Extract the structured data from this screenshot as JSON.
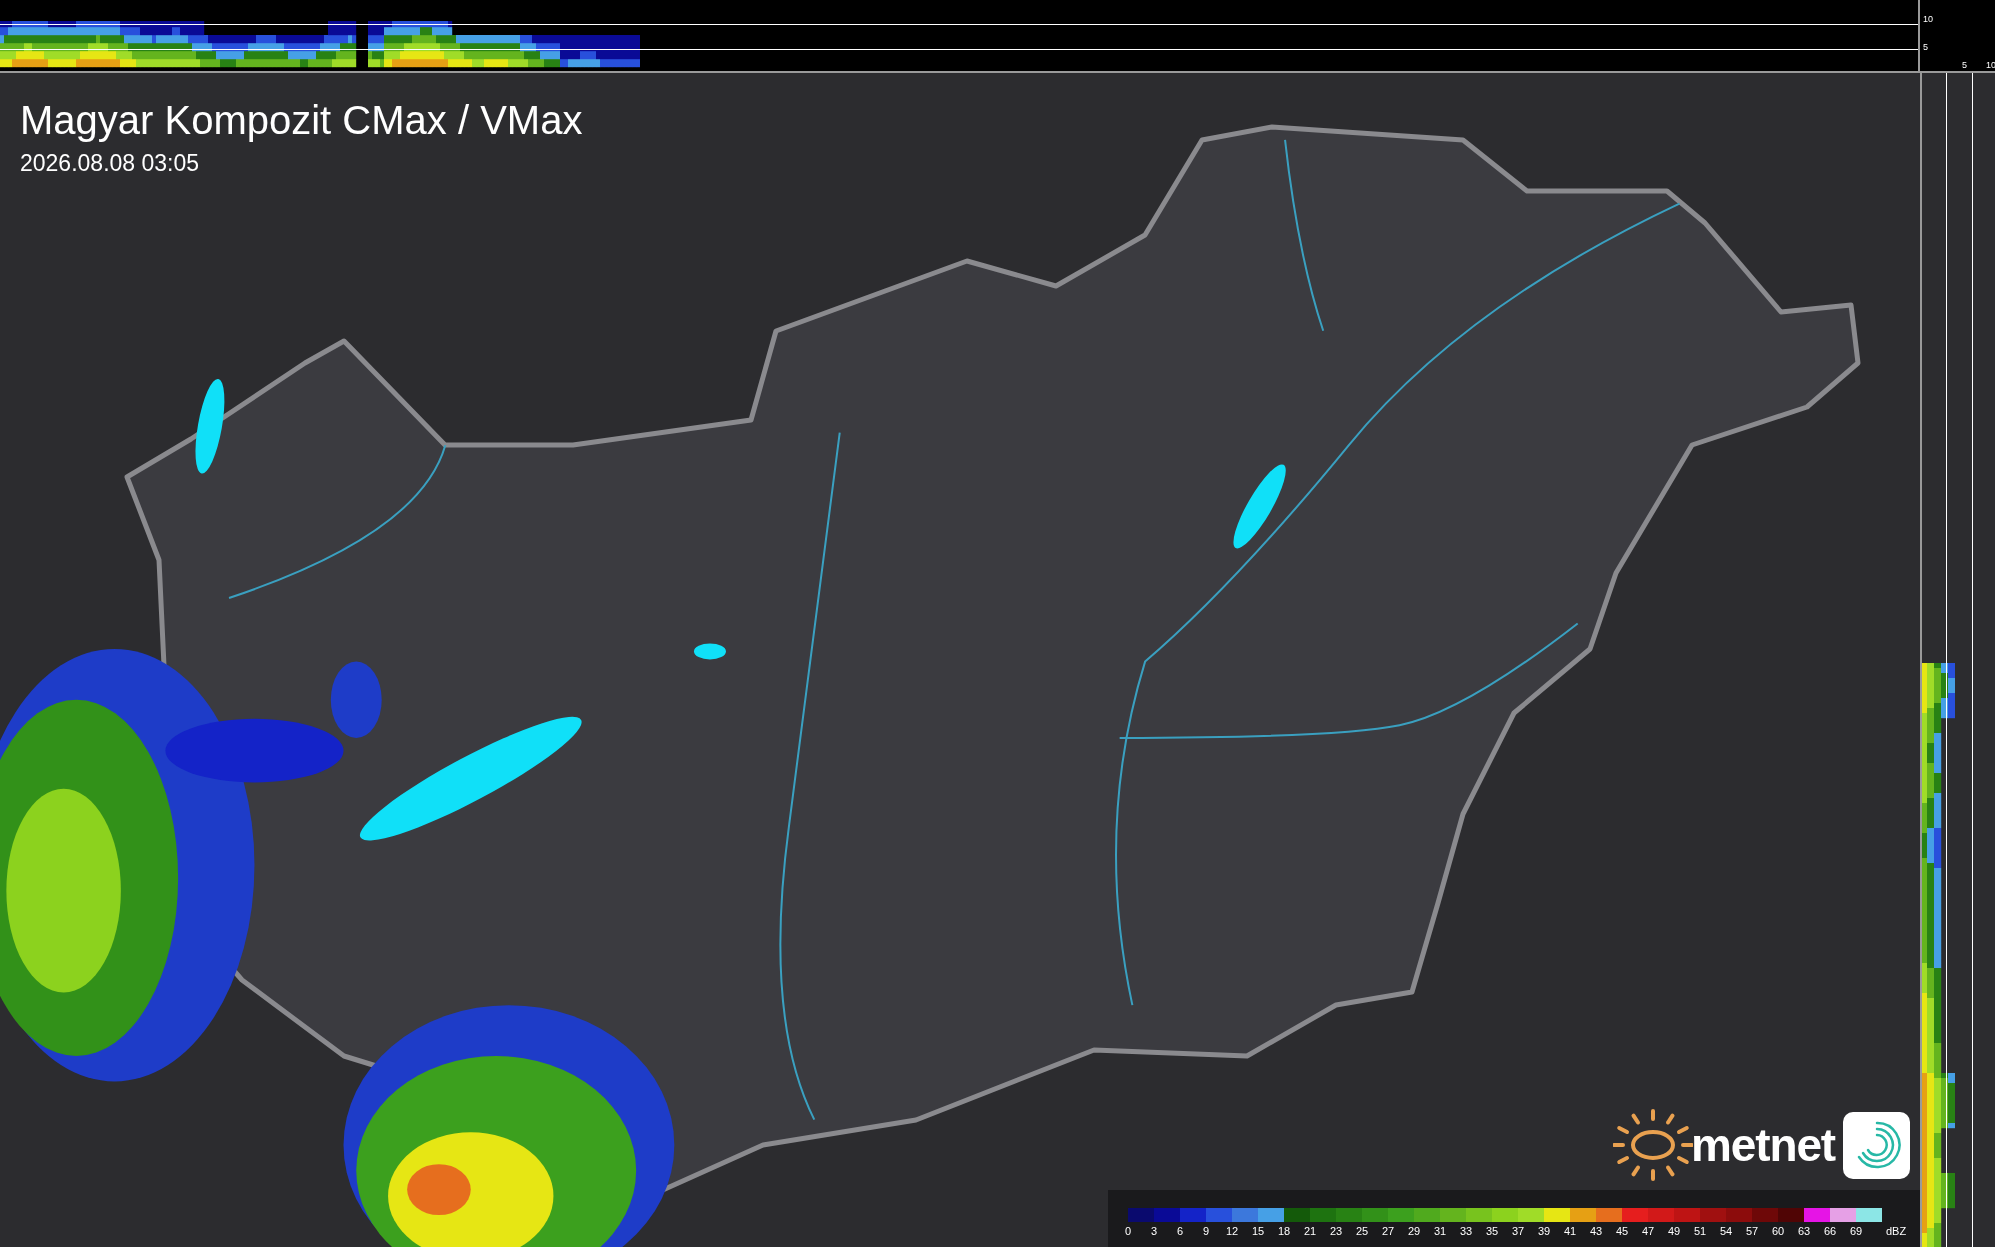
{
  "title": "Magyar Kompozit CMax / VMax",
  "timestamp": "2026.08.08 03:05",
  "top_profile": {
    "scale_labels": [
      "10",
      "5"
    ]
  },
  "side_profile": {
    "scale_labels": [
      "5",
      "10"
    ]
  },
  "logo": {
    "text": "metnet"
  },
  "legend": {
    "unit": "dBZ",
    "segments": [
      {
        "label": "0",
        "color": "#0a0a6e"
      },
      {
        "label": "3",
        "color": "#0a0a96"
      },
      {
        "label": "6",
        "color": "#1423c8"
      },
      {
        "label": "9",
        "color": "#2850dc"
      },
      {
        "label": "12",
        "color": "#3c78dc"
      },
      {
        "label": "15",
        "color": "#46a0e6"
      },
      {
        "label": "18",
        "color": "#145a0a"
      },
      {
        "label": "21",
        "color": "#1e7310"
      },
      {
        "label": "23",
        "color": "#288214"
      },
      {
        "label": "25",
        "color": "#329119"
      },
      {
        "label": "27",
        "color": "#3ca01e"
      },
      {
        "label": "29",
        "color": "#50aa1e"
      },
      {
        "label": "31",
        "color": "#64b41e"
      },
      {
        "label": "33",
        "color": "#78c31e"
      },
      {
        "label": "35",
        "color": "#8cd21e"
      },
      {
        "label": "37",
        "color": "#a0dc28"
      },
      {
        "label": "39",
        "color": "#e6e614"
      },
      {
        "label": "41",
        "color": "#e6a014"
      },
      {
        "label": "43",
        "color": "#e66e1e"
      },
      {
        "label": "45",
        "color": "#e61e1e"
      },
      {
        "label": "47",
        "color": "#d21919"
      },
      {
        "label": "49",
        "color": "#be1414"
      },
      {
        "label": "51",
        "color": "#a01010"
      },
      {
        "label": "54",
        "color": "#8c0c0c"
      },
      {
        "label": "57",
        "color": "#6e0808"
      },
      {
        "label": "60",
        "color": "#500505"
      },
      {
        "label": "63",
        "color": "#e614e6"
      },
      {
        "label": "66",
        "color": "#e6a0e6"
      },
      {
        "label": "69",
        "color": "#8ce6e6"
      }
    ]
  }
}
